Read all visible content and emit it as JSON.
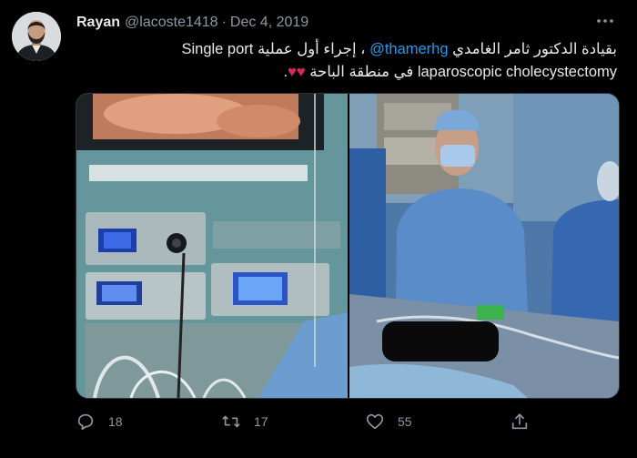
{
  "tweet": {
    "author_name": "Rayan",
    "handle": "@lacoste1418",
    "separator": "·",
    "date": "Dec 4, 2019",
    "text": {
      "line1_part1": "بقيادة الدكتور ثامر الغامدي ",
      "mention": "@thamerhg",
      "line1_part2": " ، إجراء أول عملية ",
      "line1_ltr": "Single port",
      "line2_ltr": "laparoscopic cholecystectomy",
      "line2_rtl": "  في منطقة الباحة ",
      "hearts": "♥♥",
      "period": "."
    }
  },
  "media": {
    "left_image": "laparoscopy equipment tower with monitor",
    "right_image": "surgeon in blue gown in operating room"
  },
  "actions": {
    "reply_count": "18",
    "retweet_count": "17",
    "like_count": "55"
  },
  "icons": {
    "more": "more-icon",
    "reply": "reply-icon",
    "retweet": "retweet-icon",
    "like": "like-icon",
    "share": "share-icon"
  },
  "colors": {
    "background": "#000000",
    "text": "#e7e9ea",
    "secondary": "#8b98a5",
    "link": "#1d9bf0",
    "heart": "#e0245e"
  }
}
